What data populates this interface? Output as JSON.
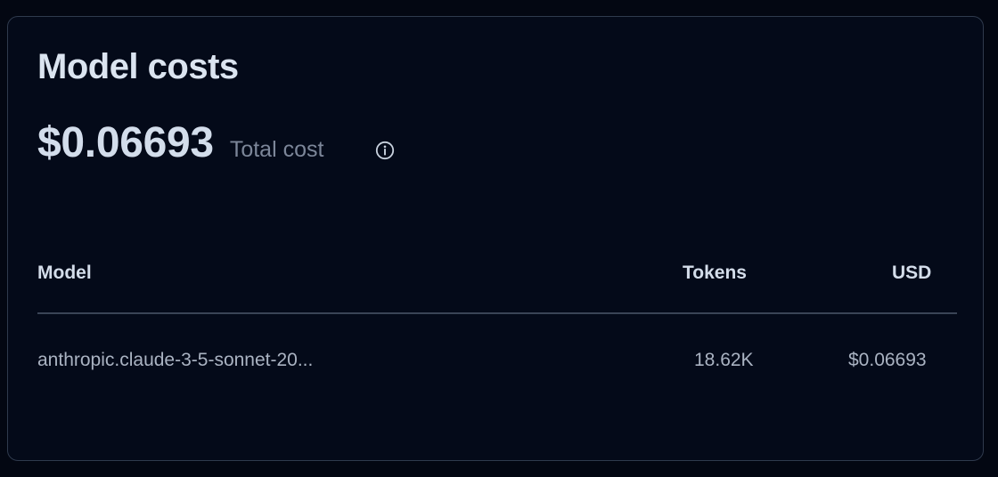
{
  "card": {
    "title": "Model costs",
    "total": {
      "value": "$0.06693",
      "label": "Total cost",
      "info_icon": "info-circle-icon"
    }
  },
  "table": {
    "columns": [
      "Model",
      "Tokens",
      "USD"
    ],
    "rows": [
      {
        "model": "anthropic.claude-3-5-sonnet-20...",
        "tokens": "18.62K",
        "usd": "$0.06693"
      }
    ]
  },
  "colors": {
    "background": "#030712",
    "card_background": "#040a19",
    "card_border": "#2f3a4d",
    "heading_text": "#dbe4f0",
    "muted_text": "#7c8699",
    "body_text": "#aab3c2"
  }
}
